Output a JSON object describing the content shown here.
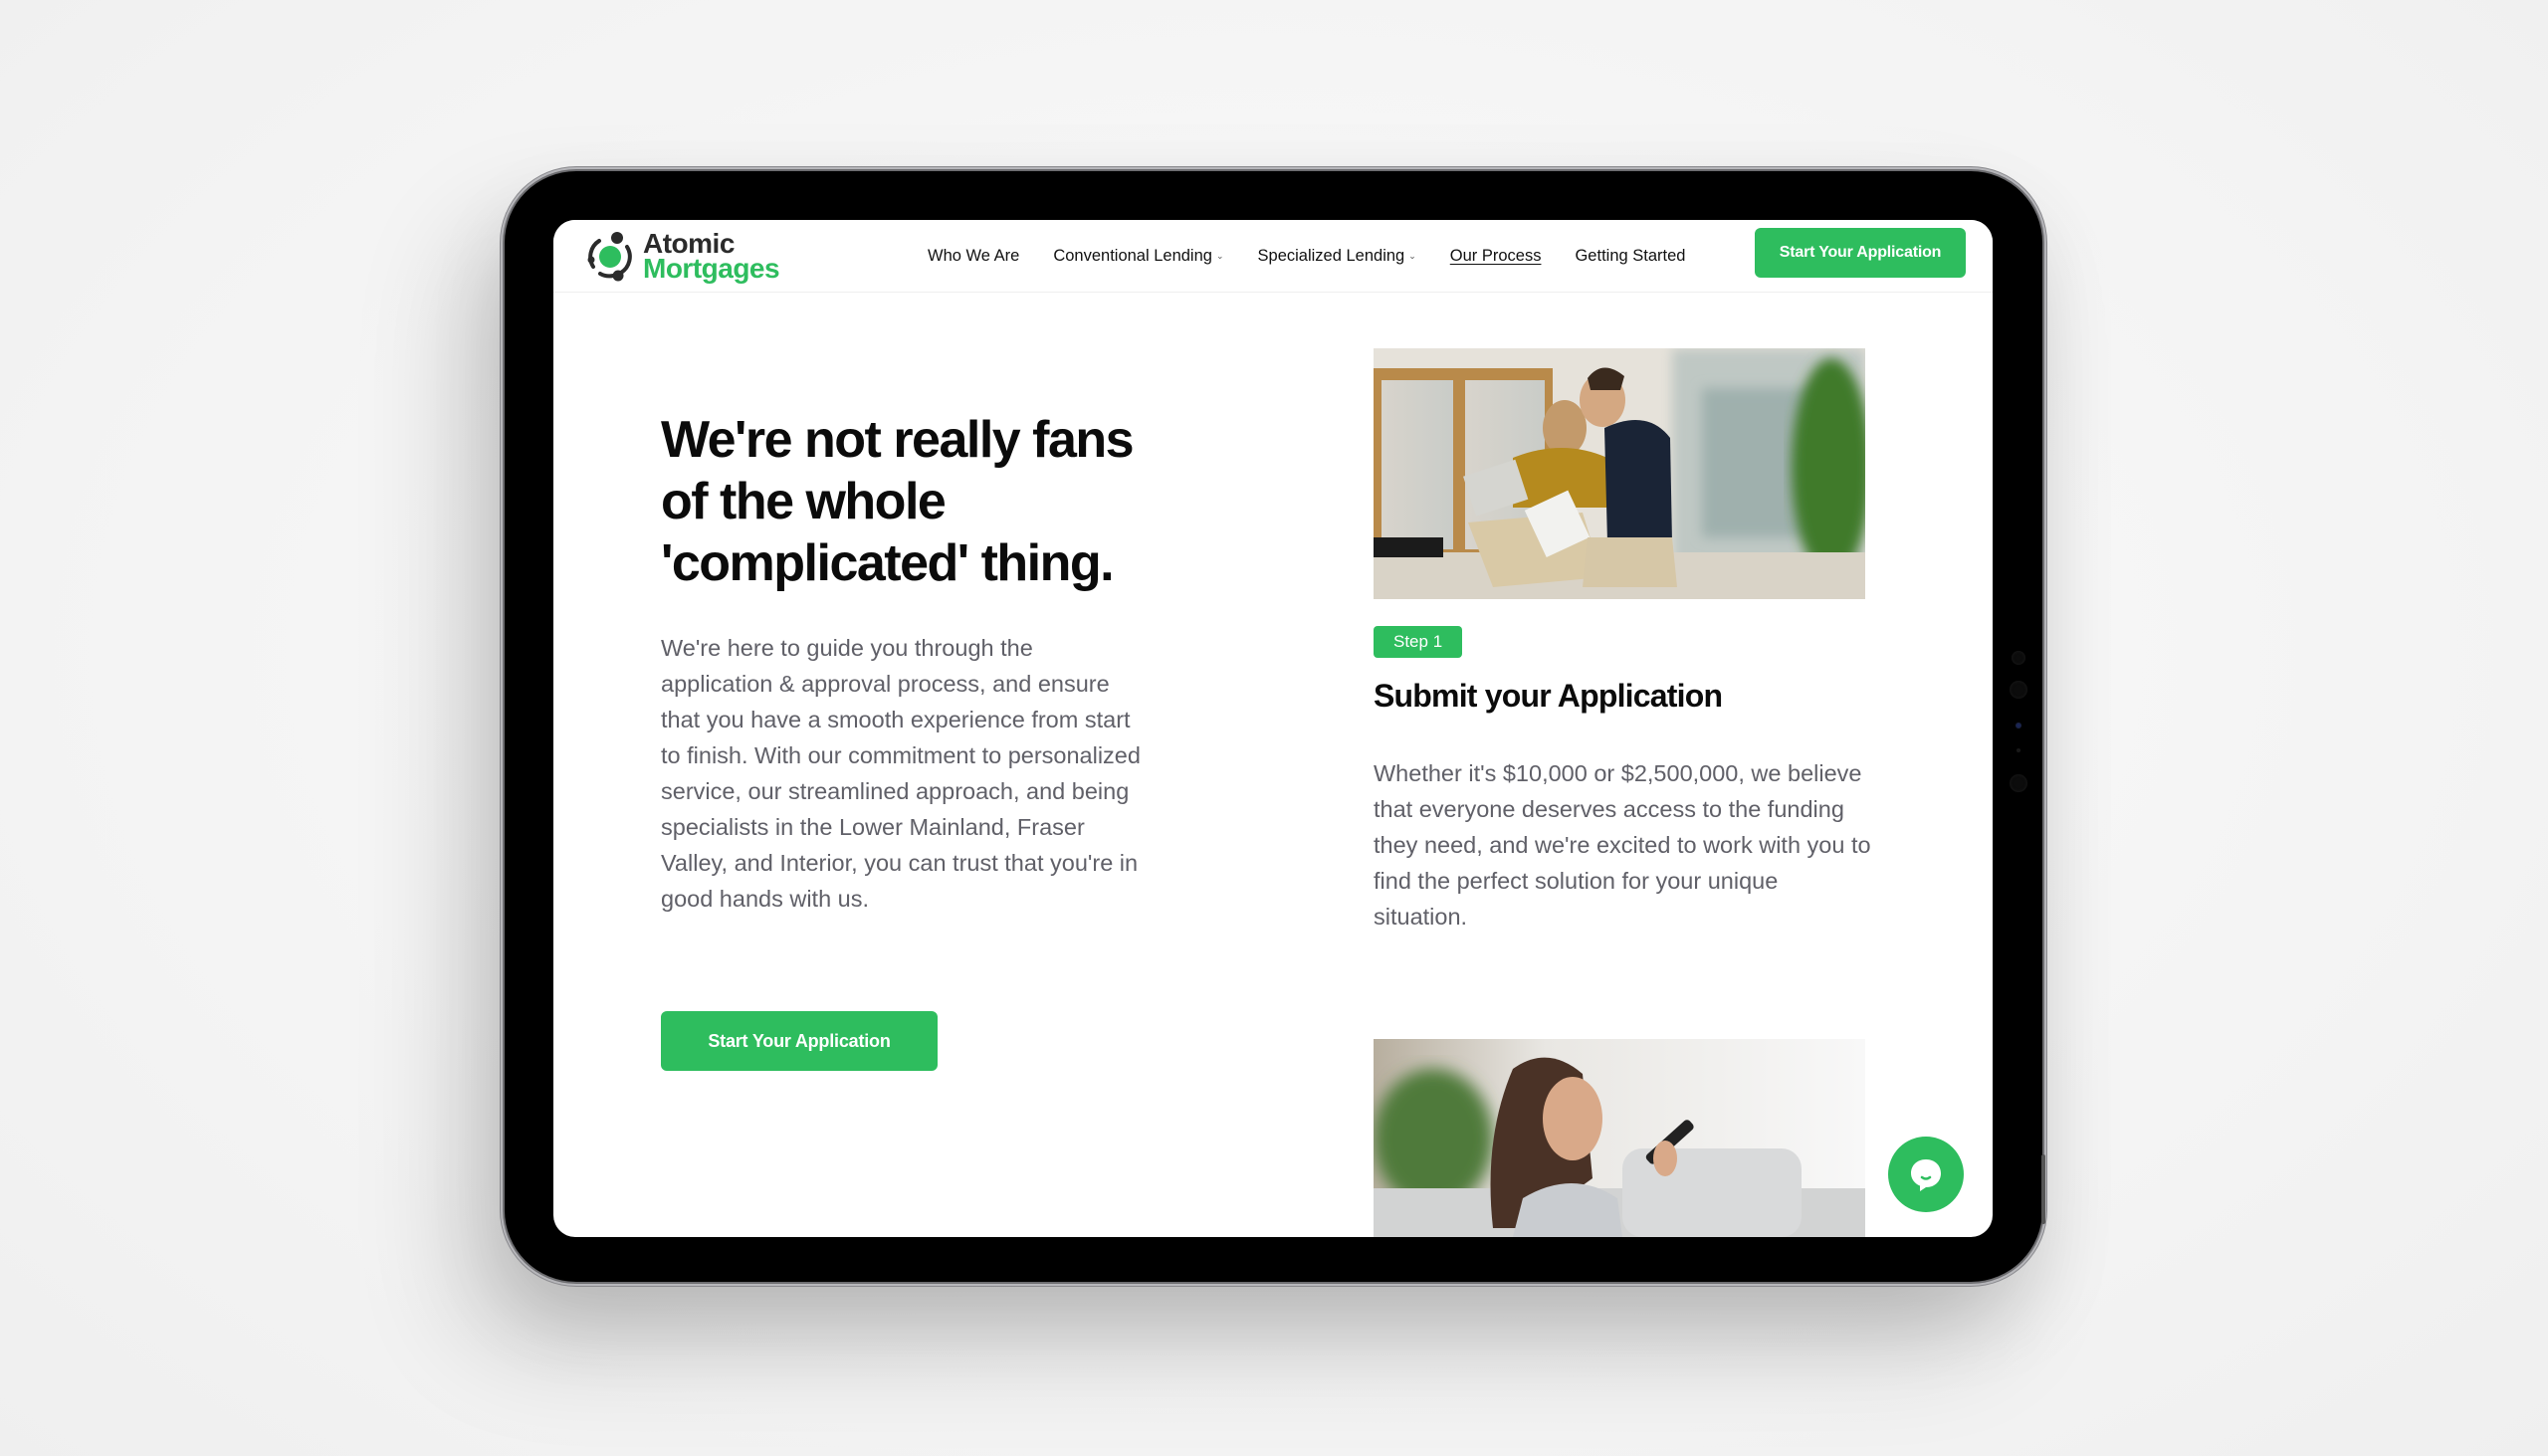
{
  "brand": {
    "name_line1": "Atomic",
    "name_line2": "Mortgages",
    "accent_color": "#2ebd5e",
    "dark_color": "#2b2b2b"
  },
  "nav": {
    "items": [
      {
        "label": "Who We Are",
        "has_dropdown": false,
        "active": false
      },
      {
        "label": "Conventional Lending",
        "has_dropdown": true,
        "active": false
      },
      {
        "label": "Specialized Lending",
        "has_dropdown": true,
        "active": false
      },
      {
        "label": "Our Process",
        "has_dropdown": false,
        "active": true
      },
      {
        "label": "Getting Started",
        "has_dropdown": false,
        "active": false
      }
    ],
    "dropdown_glyph": "⌄",
    "cta_label": "Start Your Application"
  },
  "hero": {
    "title": "We're not really fans of the whole 'complicated' thing.",
    "body": "We're here to guide you through the application & approval process, and ensure that you have a smooth experience from start to finish. With our commitment to personalized service, our streamlined approach, and being specialists in the Lower Mainland, Fraser Valley, and Interior, you can trust that you're in good hands with us.",
    "cta_label": "Start Your Application"
  },
  "steps": [
    {
      "badge": "Step 1",
      "title": "Submit your Application",
      "body": "Whether it's $10,000 or $2,500,000, we believe that everyone deserves access to the funding they need, and we're excited to work with you to find the perfect solution for your unique situation.",
      "image_alt": "Couple reviewing documents on a laptop in a bright office"
    },
    {
      "image_alt": "Woman speaking into smartphone on a couch"
    }
  ],
  "chat": {
    "icon": "chat-bubble-icon"
  }
}
